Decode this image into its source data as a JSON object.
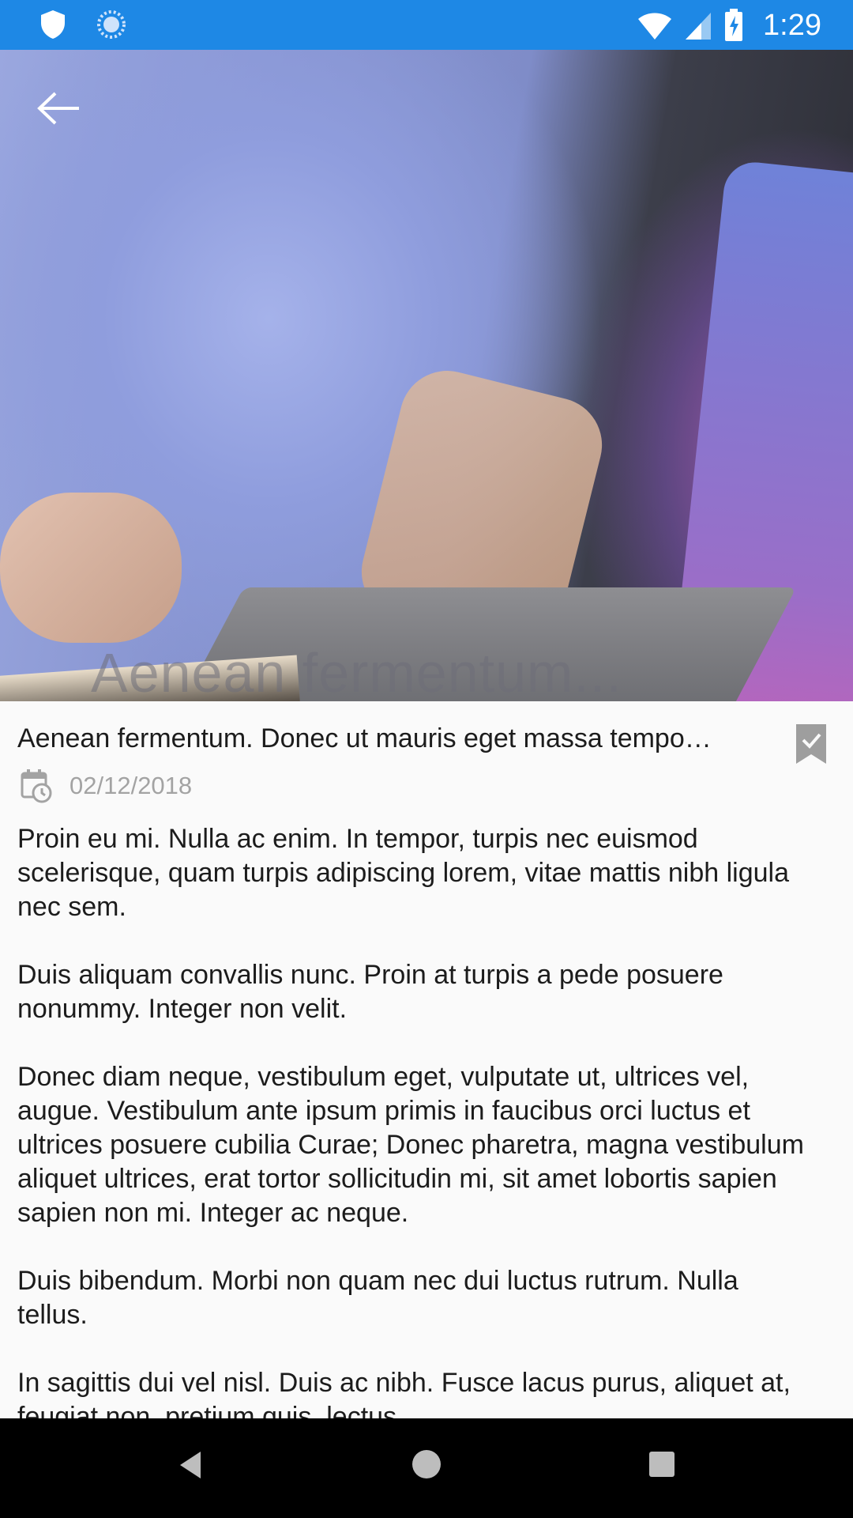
{
  "status_bar": {
    "time": "1:29",
    "icons": [
      "shield-icon",
      "sync-icon",
      "wifi-icon",
      "signal-icon",
      "battery-charging-icon"
    ],
    "background_color": "#1e88e5"
  },
  "hero": {
    "overlay_title": "Aenean fermentum...",
    "back_icon": "arrow-back-icon"
  },
  "article": {
    "title": "Aenean fermentum. Donec ut mauris eget massa tempo…",
    "date": "02/12/2018",
    "date_icon": "calendar-clock-icon",
    "bookmark_icon": "bookmark-check-icon",
    "paragraphs": [
      "Proin eu mi. Nulla ac enim. In tempor, turpis nec euismod scelerisque, quam turpis adipiscing lorem, vitae mattis nibh ligula nec sem.",
      "Duis aliquam convallis nunc. Proin at turpis a pede posuere nonummy. Integer non velit.",
      "Donec diam neque, vestibulum eget, vulputate ut, ultrices vel, augue. Vestibulum ante ipsum primis in faucibus orci luctus et ultrices posuere cubilia Curae; Donec pharetra, magna vestibulum aliquet ultrices, erat tortor sollicitudin mi, sit amet lobortis sapien sapien non mi. Integer ac neque.",
      "Duis bibendum. Morbi non quam nec dui luctus rutrum. Nulla tellus.",
      "In sagittis dui vel nisl. Duis ac nibh. Fusce lacus purus, aliquet at, feugiat non, pretium quis, lectus."
    ]
  },
  "nav_bar": {
    "buttons": [
      "nav-back-icon",
      "nav-home-icon",
      "nav-recents-icon"
    ]
  }
}
